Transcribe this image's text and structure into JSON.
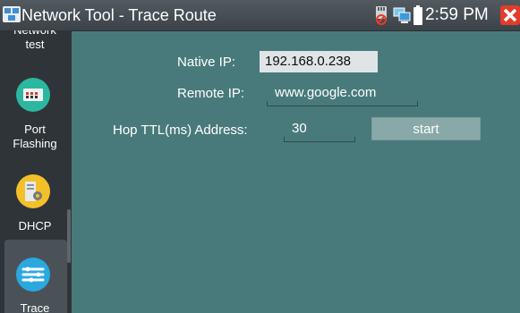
{
  "window": {
    "title": "Network Tool - Trace Route",
    "time": "2:59 PM",
    "accent": "#e23c2a",
    "background": "#497a7b"
  },
  "status_icons": [
    "sd-card-icon",
    "network-icon",
    "battery-icon"
  ],
  "sidebar": {
    "items": [
      {
        "label_top": "Network",
        "label": "test",
        "icon": "network-test-icon"
      },
      {
        "label": "Port\nFlashing",
        "icon": "port-flashing-icon",
        "icon_color": "#2cb7a1"
      },
      {
        "label": "DHCP",
        "icon": "dhcp-icon",
        "icon_color": "#f4c02a"
      },
      {
        "label": "Trace",
        "icon": "trace-route-icon",
        "icon_color": "#2aa8e0",
        "selected": true
      }
    ]
  },
  "form": {
    "native_ip_label": "Native IP:",
    "native_ip_value": "192.168.0.238",
    "remote_ip_label": "Remote IP:",
    "remote_ip_value": "www.google.com",
    "hop_ttl_label": "Hop TTL(ms) Address:",
    "hop_ttl_value": "30",
    "start_label": "start"
  }
}
